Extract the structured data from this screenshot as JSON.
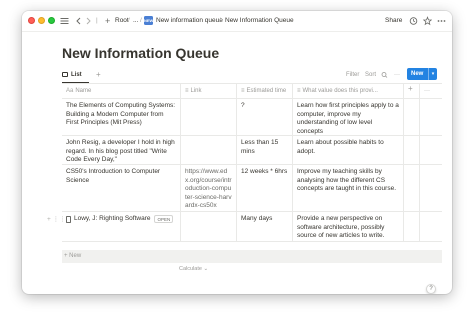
{
  "topbar": {
    "breadcrumb": [
      "Root",
      "...",
      "New information queue",
      "New Information Queue"
    ],
    "page_emoji_label": "NEW",
    "share_label": "Share"
  },
  "page": {
    "title": "New Information Queue"
  },
  "views": {
    "active_tab": "List",
    "filter_label": "Filter",
    "sort_label": "Sort",
    "new_label": "New"
  },
  "table": {
    "columns": [
      {
        "icon": "Aa",
        "label": "Name"
      },
      {
        "icon": "≡",
        "label": "Link"
      },
      {
        "icon": "≡",
        "label": "Estimated time"
      },
      {
        "icon": "≡",
        "label": "What value does this provi..."
      }
    ],
    "rows": [
      {
        "name": "The Elements of Computing Systems: Building a Modern Computer from First Principles (Mit Press)",
        "link": "",
        "time": "?",
        "value": "Learn how first principles apply to a computer, improve my understanding of low level concepts"
      },
      {
        "name": "John Resig, a developer I hold in high regard. In his blog post titled \"Write Code Every Day,\"",
        "link": "",
        "time": "Less than 15 mins",
        "value": "Learn about possible habits to adopt."
      },
      {
        "name": "CS50's Introduction to Computer Science",
        "link": "https://www.edx.org/course/introduction-computer-science-harvardx-cs50x",
        "time": "12 weeks * 6hrs",
        "value": "Improve my teaching skills by analysing how the different CS concepts are taught in this course."
      },
      {
        "name": "Lowy, J: Righting Software",
        "open_label": "OPEN",
        "link": "",
        "time": "Many days",
        "value": "Provide a new perspective on software architecture, possibly source of new articles to write."
      }
    ],
    "new_row_label": "New",
    "calculate_label": "Calculate"
  },
  "help_label": "?"
}
